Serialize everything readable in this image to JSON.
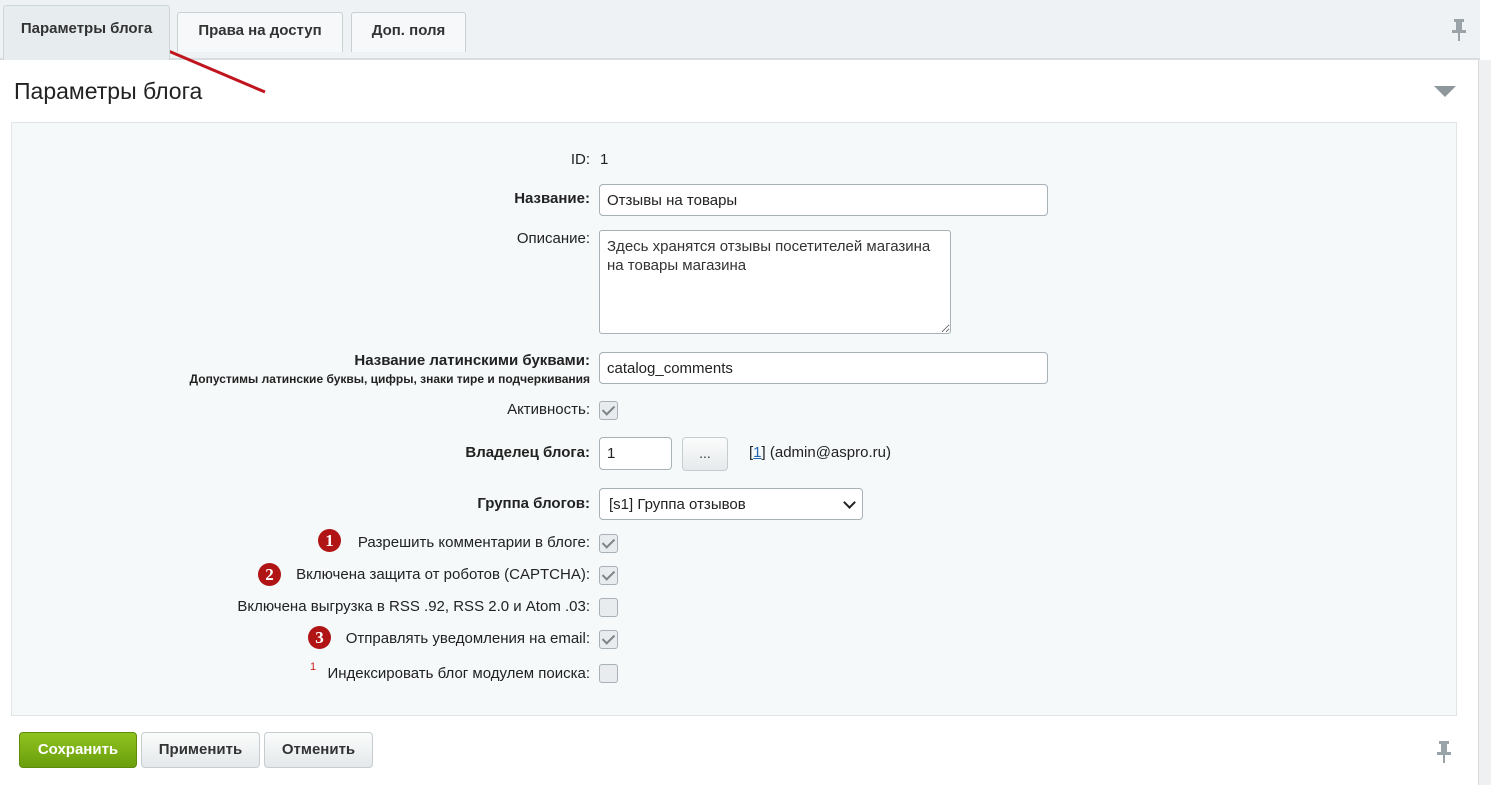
{
  "tabs": [
    {
      "label": "Параметры блога",
      "active": true
    },
    {
      "label": "Права на доступ",
      "active": false
    },
    {
      "label": "Доп. поля",
      "active": false
    }
  ],
  "section": {
    "title": "Параметры блога"
  },
  "form": {
    "id_label": "ID:",
    "id_value": "1",
    "name_label": "Название:",
    "name_value": "Отзывы на товары",
    "description_label": "Описание:",
    "description_value": "Здесь хранятся отзывы посетителей магазина на товары магазина",
    "latin_label": "Название латинскими буквами:",
    "latin_hint": "Допустимы латинские буквы, цифры, знаки тире и подчеркивания",
    "latin_value": "catalog_comments",
    "active_label": "Активность:",
    "active_checked": true,
    "owner_label": "Владелец блога:",
    "owner_value": "1",
    "owner_button": "...",
    "owner_link": "1",
    "owner_email": "(admin@aspro.ru)",
    "group_label": "Группа блогов:",
    "group_value": "[s1] Группа отзывов",
    "allow_comments_label": "Разрешить комментарии в блоге:",
    "allow_comments_checked": true,
    "captcha_label": "Включена защита от роботов (CAPTCHA):",
    "captcha_checked": true,
    "rss_label": "Включена выгрузка в RSS .92, RSS 2.0 и Atom .03:",
    "rss_checked": false,
    "email_notify_label": "Отправлять уведомления на email:",
    "email_notify_checked": true,
    "index_sup": "1",
    "index_label": "Индексировать блог модулем поиска:",
    "index_checked": false
  },
  "badges": [
    "1",
    "2",
    "3"
  ],
  "buttons": {
    "save": "Сохранить",
    "apply": "Применить",
    "cancel": "Отменить"
  },
  "colors": {
    "badge": "#b01414",
    "arrow": "#c0141e",
    "save_button": "#7cb014",
    "link": "#2067b0"
  },
  "icons": {
    "pin": "pin-icon",
    "collapse": "triangle-down-icon"
  }
}
